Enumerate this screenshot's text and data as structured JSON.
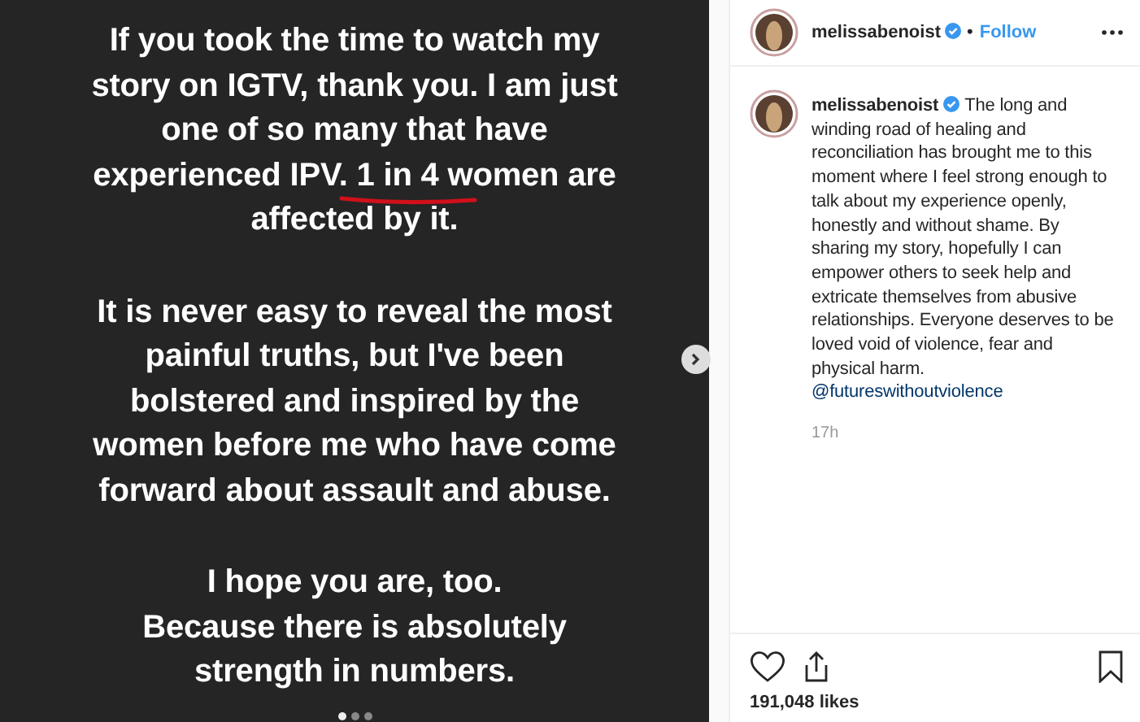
{
  "post_image": {
    "paragraphs": [
      {
        "lines": [
          "If you took the time to watch my",
          "story on IGTV, thank you. I am just",
          "one of so many that have",
          "experienced IPV. 1 in 4 women are",
          "affected by it."
        ],
        "underlined": true
      },
      {
        "lines": [
          "It is never easy to reveal the most",
          "painful truths, but I've been",
          "bolstered and inspired by the",
          "women before me who have come",
          "forward about assault and abuse."
        ],
        "underlined": false
      },
      {
        "lines": [
          "I hope you are, too.",
          "Because there is absolutely",
          "strength in numbers."
        ],
        "underlined": false
      }
    ],
    "carousel_dots": [
      {
        "selected": true
      },
      {
        "selected": false
      },
      {
        "selected": false
      }
    ]
  },
  "header": {
    "username": "melissabenoist",
    "verified": true,
    "separator": "•",
    "follow": "Follow"
  },
  "caption": {
    "username": "melissabenoist",
    "verified": true,
    "text": "The long and winding road of healing and reconciliation has brought me to this moment where I feel strong enough to talk about my experience openly, honestly and without shame. By sharing my story, hopefully I can empower others to seek help and extricate themselves from abusive relationships. Everyone deserves to be loved void of violence, fear and physical harm.",
    "mention": "@futureswithoutviolence",
    "time": "17h"
  },
  "likes": "191,048 likes"
}
